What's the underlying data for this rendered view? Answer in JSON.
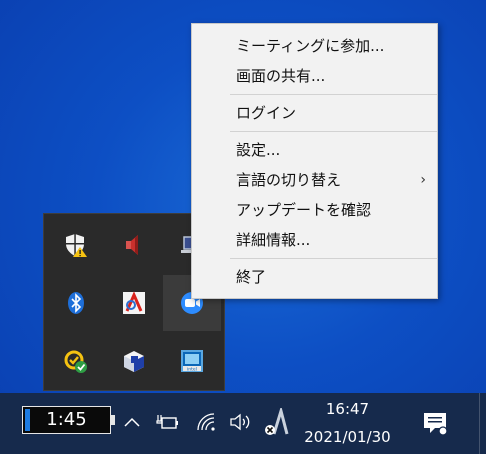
{
  "context_menu": {
    "items": [
      {
        "label": "ミーティングに参加..."
      },
      {
        "label": "画面の共有..."
      },
      {
        "label": "ログイン"
      },
      {
        "label": "設定..."
      },
      {
        "label": "言語の切り替え",
        "submenu_arrow": "›"
      },
      {
        "label": "アップデートを確認"
      },
      {
        "label": "詳細情報..."
      },
      {
        "label": "終了"
      }
    ]
  },
  "tray_flyout": {
    "icons": [
      "security-warning-icon",
      "speaker-muted-icon",
      "laptop-icon",
      "bluetooth-icon",
      "adobe-acrobat-icon",
      "zoom-icon",
      "norton-check-icon",
      "cube-app-icon",
      "intel-graphics-icon"
    ],
    "intel_badge": "intel"
  },
  "taskbar": {
    "clock_widget": "1:45",
    "time": "16:47",
    "date": "2021/01/30",
    "accent_color": "#1e7be0"
  }
}
